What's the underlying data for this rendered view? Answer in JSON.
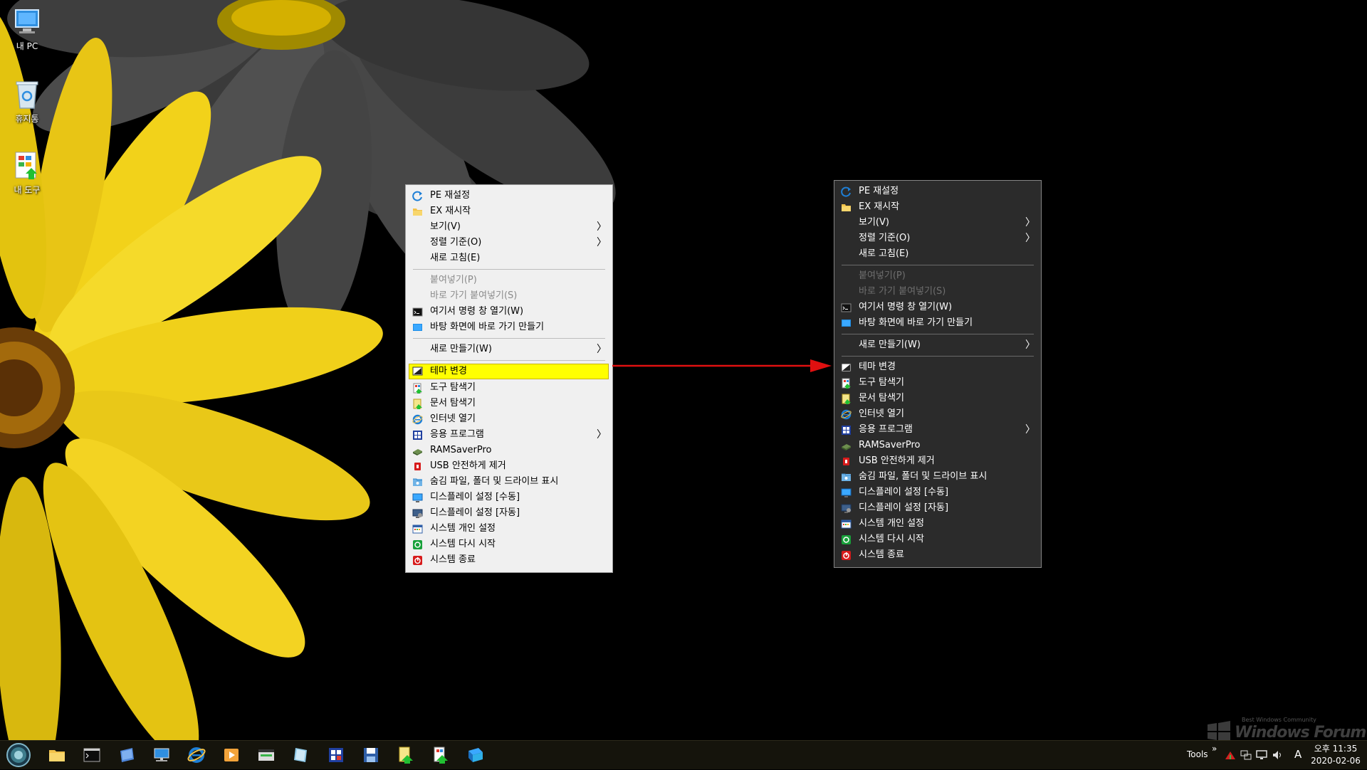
{
  "desktop": {
    "icons": [
      {
        "label": "내 PC",
        "icon": "computer-icon"
      },
      {
        "label": "휴지통",
        "icon": "recycle-bin-icon"
      },
      {
        "label": "내 도구",
        "icon": "tools-icon"
      }
    ]
  },
  "menus": {
    "light": {
      "items": [
        {
          "label": "PE 재설정",
          "icon": "refresh-icon"
        },
        {
          "label": "EX 재시작",
          "icon": "folder-icon"
        },
        {
          "label": "보기(V)",
          "submenu": true
        },
        {
          "label": "정렬 기준(O)",
          "submenu": true
        },
        {
          "label": "새로 고침(E)"
        },
        {
          "separator": true
        },
        {
          "label": "붙여넣기(P)",
          "disabled": true
        },
        {
          "label": "바로 가기 붙여넣기(S)",
          "disabled": true
        },
        {
          "label": "여기서 명령 창 열기(W)",
          "icon": "cmd-icon"
        },
        {
          "label": "바탕 화면에 바로 가기 만들기",
          "icon": "desktop-shortcut-icon"
        },
        {
          "separator": true
        },
        {
          "label": "새로 만들기(W)",
          "submenu": true
        },
        {
          "separator": true
        },
        {
          "label": "테마 변경",
          "icon": "theme-icon",
          "highlighted": true
        },
        {
          "label": "도구 탐색기",
          "icon": "tool-explorer-icon"
        },
        {
          "label": "문서 탐색기",
          "icon": "document-explorer-icon"
        },
        {
          "label": "인터넷 열기",
          "icon": "internet-explorer-icon"
        },
        {
          "label": "응용 프로그램",
          "icon": "applications-icon",
          "submenu": true
        },
        {
          "label": "RAMSaverPro",
          "icon": "ramsaver-icon"
        },
        {
          "label": "USB 안전하게 제거",
          "icon": "usb-icon"
        },
        {
          "label": "숨김 파일, 폴더 및 드라이브 표시",
          "icon": "hidden-files-icon"
        },
        {
          "label": "디스플레이 설정 [수동]",
          "icon": "display-manual-icon"
        },
        {
          "label": "디스플레이 설정 [자동]",
          "icon": "display-auto-icon"
        },
        {
          "label": "시스템 개인 설정",
          "icon": "personalize-icon"
        },
        {
          "label": "시스템 다시 시작",
          "icon": "restart-icon"
        },
        {
          "label": "시스템 종료",
          "icon": "shutdown-icon"
        }
      ]
    },
    "dark": {
      "items": [
        {
          "label": "PE 재설정",
          "icon": "refresh-icon"
        },
        {
          "label": "EX 재시작",
          "icon": "folder-icon"
        },
        {
          "label": "보기(V)",
          "submenu": true
        },
        {
          "label": "정렬 기준(O)",
          "submenu": true
        },
        {
          "label": "새로 고침(E)"
        },
        {
          "separator": true
        },
        {
          "label": "붙여넣기(P)",
          "disabled": true
        },
        {
          "label": "바로 가기 붙여넣기(S)",
          "disabled": true
        },
        {
          "label": "여기서 명령 창 열기(W)",
          "icon": "cmd-icon"
        },
        {
          "label": "바탕 화면에 바로 가기 만들기",
          "icon": "desktop-shortcut-icon"
        },
        {
          "separator": true
        },
        {
          "label": "새로 만들기(W)",
          "submenu": true
        },
        {
          "separator": true
        },
        {
          "label": "테마 변경",
          "icon": "theme-icon"
        },
        {
          "label": "도구 탐색기",
          "icon": "tool-explorer-icon"
        },
        {
          "label": "문서 탐색기",
          "icon": "document-explorer-icon"
        },
        {
          "label": "인터넷 열기",
          "icon": "internet-explorer-icon"
        },
        {
          "label": "응용 프로그램",
          "icon": "applications-icon",
          "submenu": true
        },
        {
          "label": "RAMSaverPro",
          "icon": "ramsaver-icon"
        },
        {
          "label": "USB 안전하게 제거",
          "icon": "usb-icon"
        },
        {
          "label": "숨김 파일, 폴더 및 드라이브 표시",
          "icon": "hidden-files-icon"
        },
        {
          "label": "디스플레이 설정 [수동]",
          "icon": "display-manual-icon"
        },
        {
          "label": "디스플레이 설정 [자동]",
          "icon": "display-auto-icon"
        },
        {
          "label": "시스템 개인 설정",
          "icon": "personalize-icon"
        },
        {
          "label": "시스템 다시 시작",
          "icon": "restart-icon"
        },
        {
          "label": "시스템 종료",
          "icon": "shutdown-icon"
        }
      ]
    }
  },
  "submenu_arrow": "〉",
  "colors": {
    "highlight": "#ffff00",
    "arrow": "#e01010",
    "taskbar": "#15140c"
  },
  "taskbar": {
    "pinned": [
      "file-explorer-icon",
      "command-prompt-icon",
      "documents-icon",
      "network-icon",
      "internet-explorer-icon",
      "media-player-icon",
      "disk-management-icon",
      "notepad-icon",
      "applications-icon",
      "save-icon",
      "document-explorer-icon",
      "tool-explorer-icon",
      "globe-icon"
    ],
    "tray": {
      "tools_label": "Tools",
      "chevron": "»",
      "ime": "A",
      "icons": [
        "ram-tray-icon",
        "network-tray-icon",
        "display-tray-icon",
        "volume-icon"
      ]
    },
    "clock": {
      "time": "오후 11:35",
      "date": "2020-02-06"
    }
  },
  "watermark": {
    "line1": "Best Windows Community",
    "line2": "Windows Forum"
  }
}
